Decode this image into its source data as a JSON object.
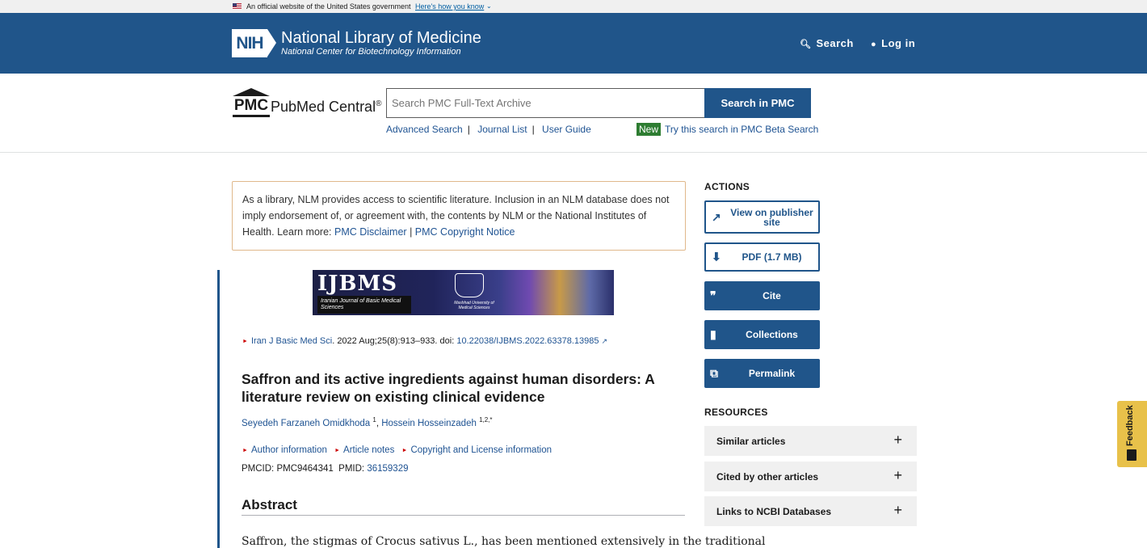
{
  "gov_banner": {
    "text": "An official website of the United States government",
    "link": "Here's how you know"
  },
  "header": {
    "nih_logo": "NIH",
    "title": "National Library of Medicine",
    "subtitle": "National Center for Biotechnology Information",
    "search_label": "Search",
    "login_label": "Log in"
  },
  "pmc_bar": {
    "logo_mark": "PMC",
    "logo_name": "PubMed Central",
    "logo_reg": "®",
    "search_placeholder": "Search PMC Full-Text Archive",
    "search_button": "Search in PMC",
    "links": [
      "Advanced Search",
      "Journal List",
      "User Guide"
    ],
    "new_badge": "New",
    "beta_link": "Try this search in PMC Beta Search"
  },
  "disclaimer": {
    "text": "As a library, NLM provides access to scientific literature. Inclusion in an NLM database does not imply endorsement of, or agreement with, the contents by NLM or the National Institutes of Health.",
    "learn_more": "Learn more:",
    "link1": "PMC Disclaimer",
    "separator": "|",
    "link2": "PMC Copyright Notice"
  },
  "journal_banner": {
    "abbrev": "IJBMS",
    "name": "Iranian Journal of Basic Medical Sciences",
    "university": "Mashhad University of Medical Sciences"
  },
  "article": {
    "journal": "Iran J Basic Med Sci",
    "citation": ". 2022 Aug;25(8):913–933. doi: ",
    "doi": "10.22038/IJBMS.2022.63378.13985",
    "title": "Saffron and its active ingredients against human disorders: A literature review on existing clinical evidence",
    "author1": "Seyedeh Farzaneh Omidkhoda",
    "author1_sup": "1",
    "author2": "Hossein Hosseinzadeh",
    "author2_sup": "1,2,*",
    "info_links": [
      "Author information",
      "Article notes",
      "Copyright and License information"
    ],
    "pmcid_label": "PMCID: PMC9464341",
    "pmid_label": "PMID:",
    "pmid": "36159329",
    "abstract_heading": "Abstract",
    "abstract_start": "Saffron, the stigmas of Crocus sativus L., has been mentioned extensively in the traditional"
  },
  "actions": {
    "heading": "ACTIONS",
    "publisher": "View on publisher site",
    "pdf": "PDF (1.7 MB)",
    "cite": "Cite",
    "collections": "Collections",
    "permalink": "Permalink"
  },
  "resources": {
    "heading": "RESOURCES",
    "items": [
      "Similar articles",
      "Cited by other articles",
      "Links to NCBI Databases"
    ]
  },
  "feedback": "Feedback"
}
